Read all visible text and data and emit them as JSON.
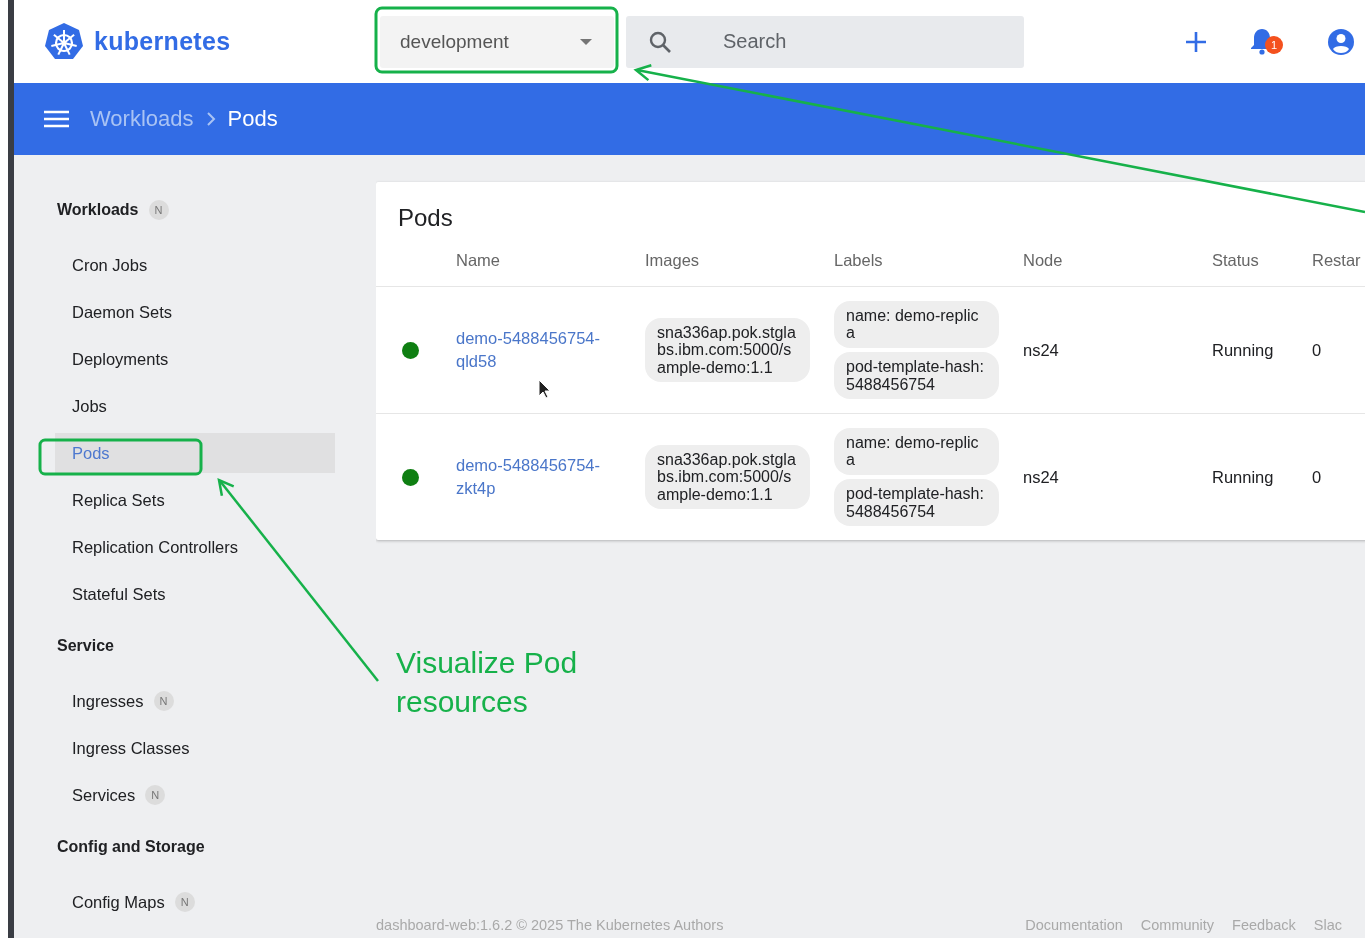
{
  "header": {
    "logo_text": "kubernetes",
    "namespace": "development",
    "search": {
      "placeholder": "Search"
    },
    "notification_count": "1"
  },
  "breadcrumb": [
    {
      "label": "Workloads",
      "selected": false
    },
    {
      "label": "Pods",
      "selected": true
    }
  ],
  "sidebar": {
    "sections": [
      {
        "title": "Workloads",
        "badge": "N",
        "items": [
          {
            "label": "Cron Jobs",
            "selected": false
          },
          {
            "label": "Daemon Sets",
            "selected": false
          },
          {
            "label": "Deployments",
            "selected": false
          },
          {
            "label": "Jobs",
            "selected": false
          },
          {
            "label": "Pods",
            "selected": true
          },
          {
            "label": "Replica Sets",
            "selected": false
          },
          {
            "label": "Replication Controllers",
            "selected": false
          },
          {
            "label": "Stateful Sets",
            "selected": false
          }
        ]
      },
      {
        "title": "Service",
        "items": [
          {
            "label": "Ingresses",
            "badge": "N",
            "selected": false
          },
          {
            "label": "Ingress Classes",
            "selected": false
          },
          {
            "label": "Services",
            "badge": "N",
            "selected": false
          }
        ]
      },
      {
        "title": "Config and Storage",
        "items": [
          {
            "label": "Config Maps",
            "badge": "N",
            "selected": false
          }
        ]
      }
    ]
  },
  "card": {
    "title": "Pods",
    "columns": [
      "Name",
      "Images",
      "Labels",
      "Node",
      "Status",
      "Restar"
    ],
    "rows": [
      {
        "color": "#0f7f12",
        "name": "demo-5488456754-qld58",
        "images": [
          "sna336ap.pok.stglabs.ibm.com:5000/sample-demo:1.1"
        ],
        "labels": [
          "name: demo-replica",
          "pod-template-hash: 5488456754"
        ],
        "node": "ns24",
        "status": "Running",
        "restarts": "0"
      },
      {
        "color": "#0f7f12",
        "name": "demo-5488456754-zkt4p",
        "images": [
          "sna336ap.pok.stglabs.ibm.com:5000/sample-demo:1.1"
        ],
        "labels": [
          "name: demo-replica",
          "pod-template-hash: 5488456754"
        ],
        "node": "ns24",
        "status": "Running",
        "restarts": "0"
      }
    ]
  },
  "footer": {
    "copyright": "dashboard-web:1.6.2 © 2025 The Kubernetes Authors",
    "links": [
      "Documentation",
      "Community",
      "Feedback",
      "Slac"
    ]
  },
  "annotation": {
    "callout": "Visualize Pod resources"
  }
}
